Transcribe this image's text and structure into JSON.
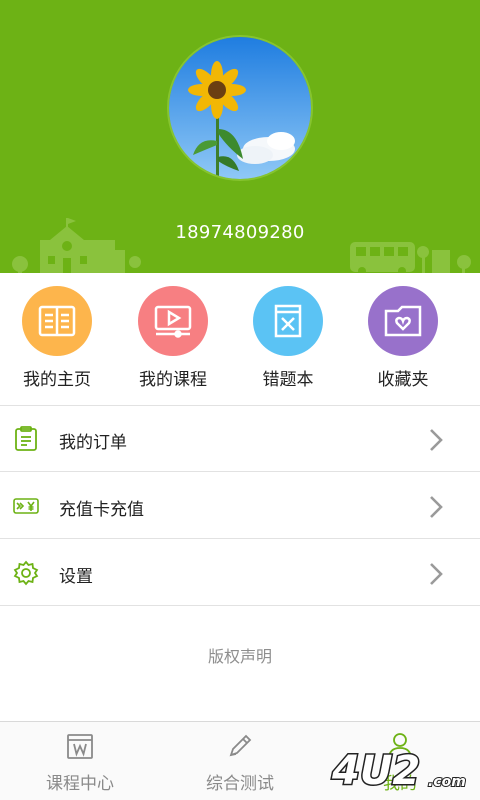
{
  "profile": {
    "phone": "18974809280",
    "avatar_icon": "sunflower-avatar"
  },
  "shortcuts": [
    {
      "label": "我的主页",
      "icon": "book-icon",
      "color": "#fdb54c"
    },
    {
      "label": "我的课程",
      "icon": "video-play-icon",
      "color": "#f77f82"
    },
    {
      "label": "错题本",
      "icon": "mistake-book-icon",
      "color": "#5bc3f4"
    },
    {
      "label": "收藏夹",
      "icon": "favorite-folder-icon",
      "color": "#9871cb"
    }
  ],
  "menu": [
    {
      "label": "我的订单",
      "icon": "order-list-icon"
    },
    {
      "label": "充值卡充值",
      "icon": "recharge-card-icon"
    },
    {
      "label": "设置",
      "icon": "settings-gear-icon"
    }
  ],
  "copyright": "版权声明",
  "tabs": [
    {
      "label": "课程中心",
      "icon": "course-center-icon",
      "active": false
    },
    {
      "label": "综合测试",
      "icon": "pencil-icon",
      "active": false
    },
    {
      "label": "我的",
      "icon": "person-icon",
      "active": true
    }
  ],
  "colors": {
    "brand_green": "#6db215",
    "divider": "#e2e2e2",
    "muted_text": "#8e8e8e"
  },
  "watermark": "4U2.com"
}
